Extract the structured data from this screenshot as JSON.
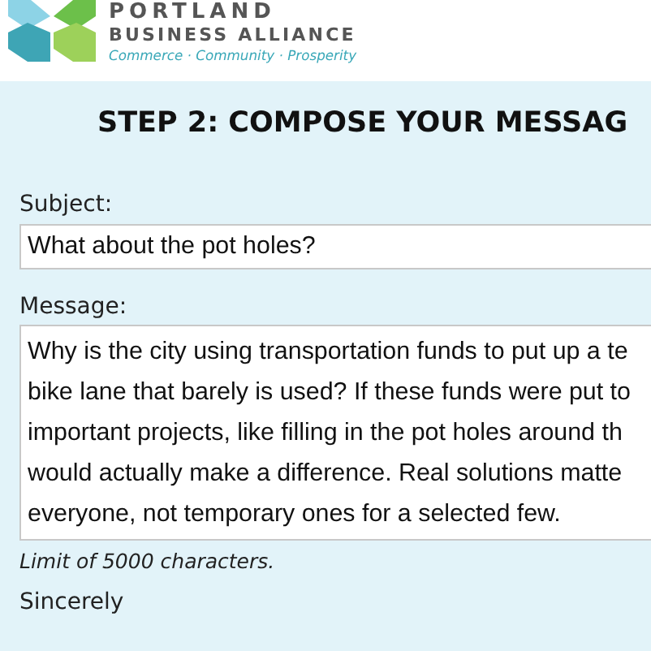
{
  "header": {
    "logo_name": "PORTLAND",
    "logo_subtitle": "BUSINESS ALLIANCE",
    "tagline": "Commerce · Community · Prosperity"
  },
  "form": {
    "heading": "STEP 2: COMPOSE YOUR MESSAG",
    "subject": {
      "label": "Subject:",
      "value": "What about the pot holes?"
    },
    "message": {
      "label": "Message:",
      "lines": [
        "Why is the city using transportation funds to put up a te",
        "bike lane that barely is used? If these funds were put to",
        "important projects, like filling in the pot holes around th",
        "would actually make a difference. Real solutions matte",
        "everyone, not temporary ones for a selected few."
      ]
    },
    "hint": "Limit of 5000 characters.",
    "closing": "Sincerely"
  }
}
